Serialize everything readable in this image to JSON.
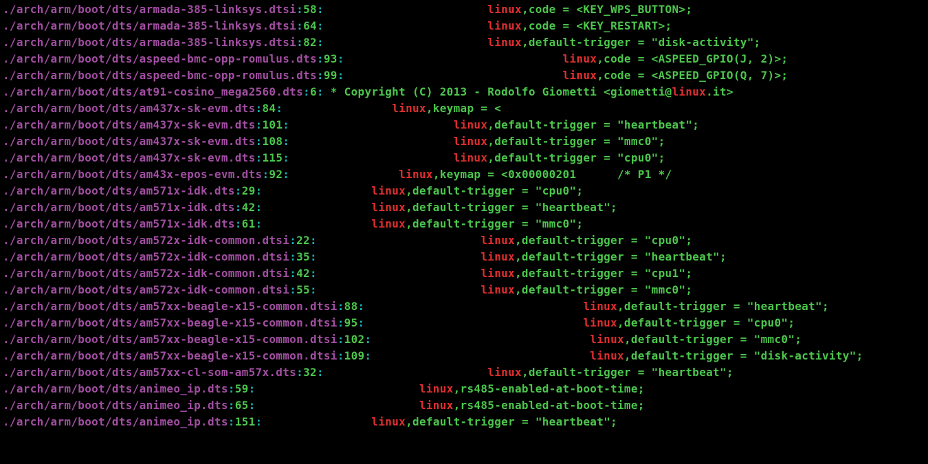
{
  "match_word": "linux",
  "lines": [
    {
      "path": "./arch/arm/boot/dts/armada-385-linksys.dtsi",
      "lineno": "58",
      "segments": [
        {
          "t": "txt",
          "v": "\t\t\t"
        },
        {
          "t": "match",
          "v": "linux"
        },
        {
          "t": "txt",
          "v": ",code = <KEY_WPS_BUTTON>;"
        }
      ]
    },
    {
      "path": "./arch/arm/boot/dts/armada-385-linksys.dtsi",
      "lineno": "64",
      "segments": [
        {
          "t": "txt",
          "v": "\t\t\t"
        },
        {
          "t": "match",
          "v": "linux"
        },
        {
          "t": "txt",
          "v": ",code = <KEY_RESTART>;"
        }
      ]
    },
    {
      "path": "./arch/arm/boot/dts/armada-385-linksys.dtsi",
      "lineno": "82",
      "segments": [
        {
          "t": "txt",
          "v": "\t\t\t"
        },
        {
          "t": "match",
          "v": "linux"
        },
        {
          "t": "txt",
          "v": ",default-trigger = \"disk-activity\";"
        }
      ]
    },
    {
      "path": "./arch/arm/boot/dts/aspeed-bmc-opp-romulus.dts",
      "lineno": "93",
      "segments": [
        {
          "t": "txt",
          "v": "\t\t\t\t"
        },
        {
          "t": "match",
          "v": "linux"
        },
        {
          "t": "txt",
          "v": ",code = <ASPEED_GPIO(J, 2)>;"
        }
      ]
    },
    {
      "path": "./arch/arm/boot/dts/aspeed-bmc-opp-romulus.dts",
      "lineno": "99",
      "segments": [
        {
          "t": "txt",
          "v": "\t\t\t\t"
        },
        {
          "t": "match",
          "v": "linux"
        },
        {
          "t": "txt",
          "v": ",code = <ASPEED_GPIO(Q, 7)>;"
        }
      ]
    },
    {
      "path": "./arch/arm/boot/dts/at91-cosino_mega2560.dts",
      "lineno": "6",
      "segments": [
        {
          "t": "txt",
          "v": " * Copyright (C) 2013 - Rodolfo Giometti <giometti@"
        },
        {
          "t": "match",
          "v": "linux"
        },
        {
          "t": "txt",
          "v": ".it>"
        }
      ]
    },
    {
      "path": "./arch/arm/boot/dts/am437x-sk-evm.dts",
      "lineno": "84",
      "segments": [
        {
          "t": "txt",
          "v": "\t\t"
        },
        {
          "t": "match",
          "v": "linux"
        },
        {
          "t": "txt",
          "v": ",keymap = <"
        }
      ]
    },
    {
      "path": "./arch/arm/boot/dts/am437x-sk-evm.dts",
      "lineno": "101",
      "segments": [
        {
          "t": "txt",
          "v": "\t\t\t"
        },
        {
          "t": "match",
          "v": "linux"
        },
        {
          "t": "txt",
          "v": ",default-trigger = \"heartbeat\";"
        }
      ]
    },
    {
      "path": "./arch/arm/boot/dts/am437x-sk-evm.dts",
      "lineno": "108",
      "segments": [
        {
          "t": "txt",
          "v": "\t\t\t"
        },
        {
          "t": "match",
          "v": "linux"
        },
        {
          "t": "txt",
          "v": ",default-trigger = \"mmc0\";"
        }
      ]
    },
    {
      "path": "./arch/arm/boot/dts/am437x-sk-evm.dts",
      "lineno": "115",
      "segments": [
        {
          "t": "txt",
          "v": "\t\t\t"
        },
        {
          "t": "match",
          "v": "linux"
        },
        {
          "t": "txt",
          "v": ",default-trigger = \"cpu0\";"
        }
      ]
    },
    {
      "path": "./arch/arm/boot/dts/am43x-epos-evm.dts",
      "lineno": "92",
      "segments": [
        {
          "t": "txt",
          "v": "\t\t"
        },
        {
          "t": "match",
          "v": "linux"
        },
        {
          "t": "txt",
          "v": ",keymap = <0x00000201\t/* P1 */"
        }
      ]
    },
    {
      "path": "./arch/arm/boot/dts/am571x-idk.dts",
      "lineno": "29",
      "segments": [
        {
          "t": "txt",
          "v": "\t\t"
        },
        {
          "t": "match",
          "v": "linux"
        },
        {
          "t": "txt",
          "v": ",default-trigger = \"cpu0\";"
        }
      ]
    },
    {
      "path": "./arch/arm/boot/dts/am571x-idk.dts",
      "lineno": "42",
      "segments": [
        {
          "t": "txt",
          "v": "\t\t"
        },
        {
          "t": "match",
          "v": "linux"
        },
        {
          "t": "txt",
          "v": ",default-trigger = \"heartbeat\";"
        }
      ]
    },
    {
      "path": "./arch/arm/boot/dts/am571x-idk.dts",
      "lineno": "61",
      "segments": [
        {
          "t": "txt",
          "v": "\t\t"
        },
        {
          "t": "match",
          "v": "linux"
        },
        {
          "t": "txt",
          "v": ",default-trigger = \"mmc0\";"
        }
      ]
    },
    {
      "path": "./arch/arm/boot/dts/am572x-idk-common.dtsi",
      "lineno": "22",
      "segments": [
        {
          "t": "txt",
          "v": "\t\t\t"
        },
        {
          "t": "match",
          "v": "linux"
        },
        {
          "t": "txt",
          "v": ",default-trigger = \"cpu0\";"
        }
      ]
    },
    {
      "path": "./arch/arm/boot/dts/am572x-idk-common.dtsi",
      "lineno": "35",
      "segments": [
        {
          "t": "txt",
          "v": "\t\t\t"
        },
        {
          "t": "match",
          "v": "linux"
        },
        {
          "t": "txt",
          "v": ",default-trigger = \"heartbeat\";"
        }
      ]
    },
    {
      "path": "./arch/arm/boot/dts/am572x-idk-common.dtsi",
      "lineno": "42",
      "segments": [
        {
          "t": "txt",
          "v": "\t\t\t"
        },
        {
          "t": "match",
          "v": "linux"
        },
        {
          "t": "txt",
          "v": ",default-trigger = \"cpu1\";"
        }
      ]
    },
    {
      "path": "./arch/arm/boot/dts/am572x-idk-common.dtsi",
      "lineno": "55",
      "segments": [
        {
          "t": "txt",
          "v": "\t\t\t"
        },
        {
          "t": "match",
          "v": "linux"
        },
        {
          "t": "txt",
          "v": ",default-trigger = \"mmc0\";"
        }
      ]
    },
    {
      "path": "./arch/arm/boot/dts/am57xx-beagle-x15-common.dtsi",
      "lineno": "88",
      "segments": [
        {
          "t": "txt",
          "v": "\t\t\t\t"
        },
        {
          "t": "match",
          "v": "linux"
        },
        {
          "t": "txt",
          "v": ",default-trigger = \"heartbeat\";"
        }
      ]
    },
    {
      "path": "./arch/arm/boot/dts/am57xx-beagle-x15-common.dtsi",
      "lineno": "95",
      "segments": [
        {
          "t": "txt",
          "v": "\t\t\t\t"
        },
        {
          "t": "match",
          "v": "linux"
        },
        {
          "t": "txt",
          "v": ",default-trigger = \"cpu0\";"
        }
      ]
    },
    {
      "path": "./arch/arm/boot/dts/am57xx-beagle-x15-common.dtsi",
      "lineno": "102",
      "segments": [
        {
          "t": "txt",
          "v": "\t\t\t\t"
        },
        {
          "t": "match",
          "v": "linux"
        },
        {
          "t": "txt",
          "v": ",default-trigger = \"mmc0\";"
        }
      ]
    },
    {
      "path": "./arch/arm/boot/dts/am57xx-beagle-x15-common.dtsi",
      "lineno": "109",
      "segments": [
        {
          "t": "txt",
          "v": "\t\t\t\t"
        },
        {
          "t": "match",
          "v": "linux"
        },
        {
          "t": "txt",
          "v": ",default-trigger = \"disk-activity\";"
        }
      ]
    },
    {
      "path": "./arch/arm/boot/dts/am57xx-cl-som-am57x.dts",
      "lineno": "32",
      "segments": [
        {
          "t": "txt",
          "v": "\t\t\t"
        },
        {
          "t": "match",
          "v": "linux"
        },
        {
          "t": "txt",
          "v": ",default-trigger = \"heartbeat\";"
        }
      ]
    },
    {
      "path": "./arch/arm/boot/dts/animeo_ip.dts",
      "lineno": "59",
      "segments": [
        {
          "t": "txt",
          "v": "\t\t\t"
        },
        {
          "t": "match",
          "v": "linux"
        },
        {
          "t": "txt",
          "v": ",rs485-enabled-at-boot-time;"
        }
      ]
    },
    {
      "path": "./arch/arm/boot/dts/animeo_ip.dts",
      "lineno": "65",
      "segments": [
        {
          "t": "txt",
          "v": "\t\t\t"
        },
        {
          "t": "match",
          "v": "linux"
        },
        {
          "t": "txt",
          "v": ",rs485-enabled-at-boot-time;"
        }
      ]
    },
    {
      "path": "./arch/arm/boot/dts/animeo_ip.dts",
      "lineno": "151",
      "segments": [
        {
          "t": "txt",
          "v": "\t\t"
        },
        {
          "t": "match",
          "v": "linux"
        },
        {
          "t": "txt",
          "v": ",default-trigger = \"heartbeat\";"
        }
      ]
    }
  ]
}
